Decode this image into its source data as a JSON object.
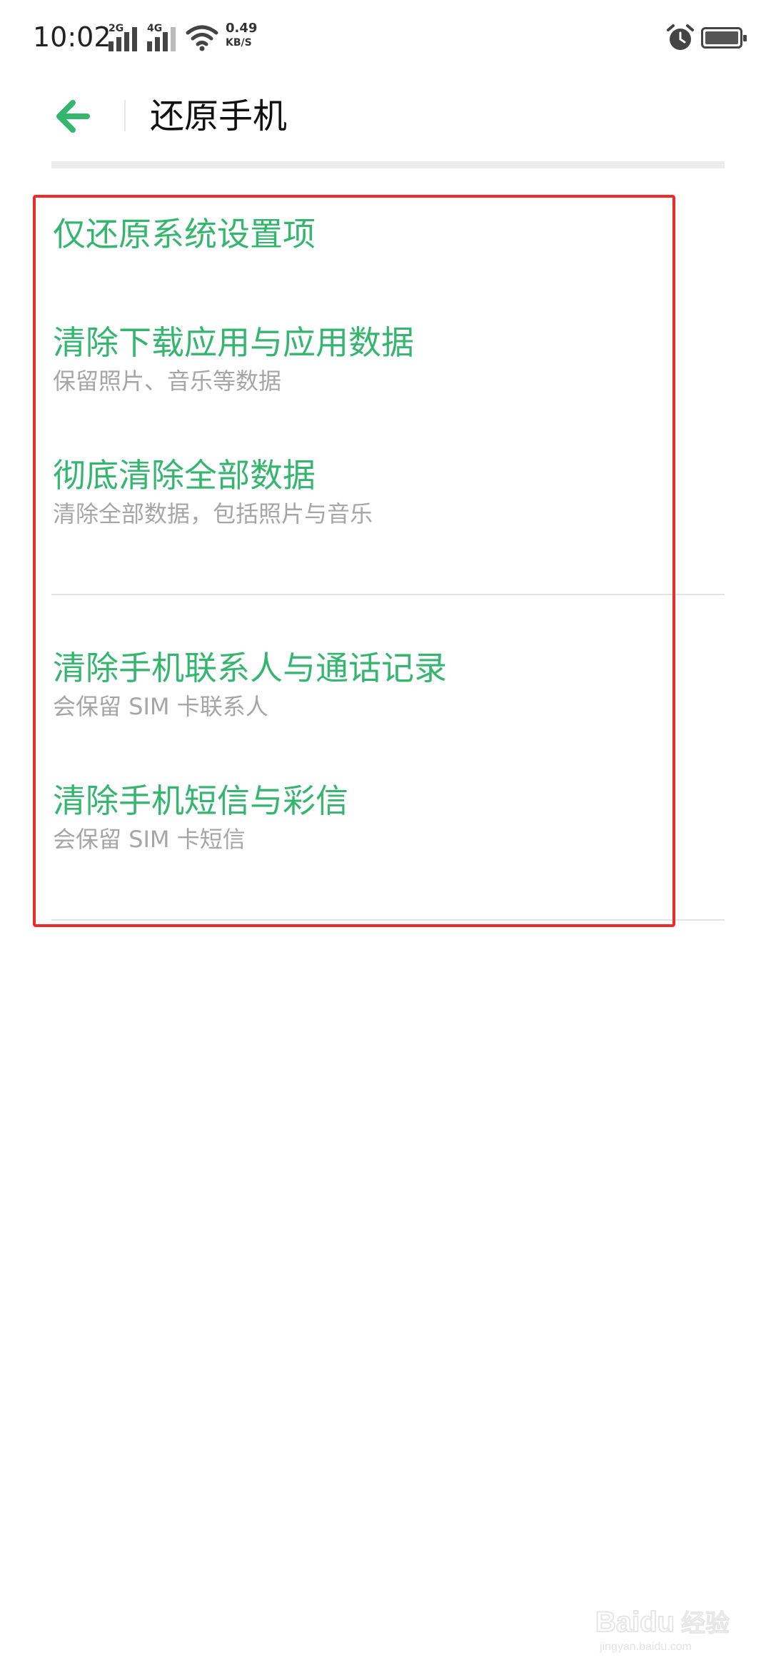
{
  "status_bar": {
    "time": "10:02",
    "signal_1_label": "2G",
    "signal_2_label": "4G",
    "speed_value": "0.49",
    "speed_unit": "KB/S",
    "icons": [
      "signal-2g-icon",
      "signal-4g-icon",
      "wifi-icon",
      "alarm-icon",
      "battery-icon"
    ]
  },
  "header": {
    "back_icon": "back-arrow-icon",
    "title": "还原手机"
  },
  "options": [
    {
      "title": "仅还原系统设置项",
      "subtitle": ""
    },
    {
      "title": "清除下载应用与应用数据",
      "subtitle": "保留照片、音乐等数据"
    },
    {
      "title": "彻底清除全部数据",
      "subtitle": "清除全部数据，包括照片与音乐"
    },
    {
      "title": "清除手机联系人与通话记录",
      "subtitle": "会保留 SIM 卡联系人"
    },
    {
      "title": "清除手机短信与彩信",
      "subtitle": "会保留 SIM 卡短信"
    }
  ],
  "colors": {
    "accent": "#35b66f",
    "subtitle": "#a6a6a6",
    "highlight": "#ee2a2a"
  },
  "watermark": {
    "brand": "Baidu",
    "cn": "经验",
    "url": "jingyan.baidu.com"
  }
}
